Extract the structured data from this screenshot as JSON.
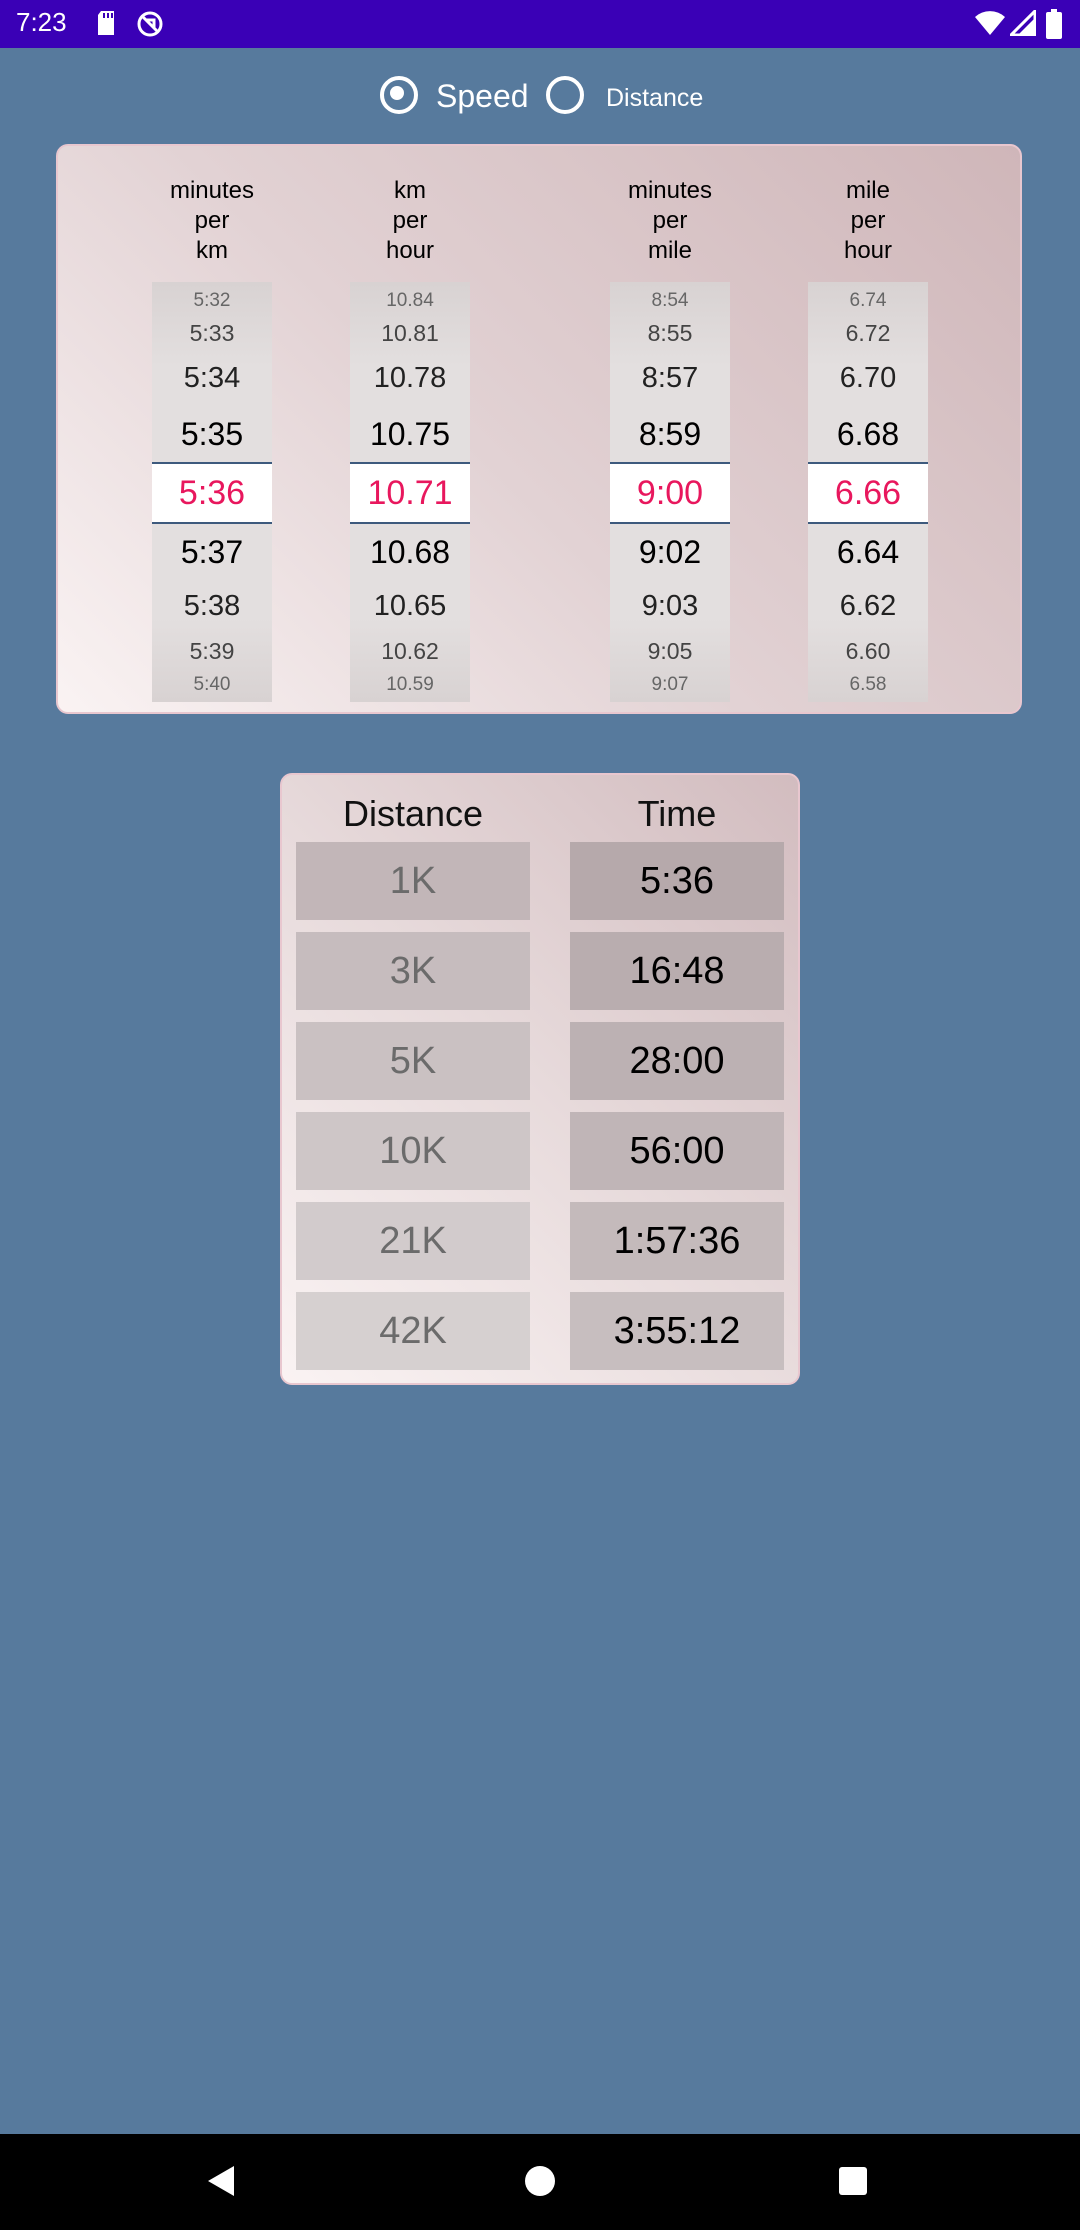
{
  "status_bar": {
    "time": "7:23",
    "icons": [
      "sd-card-icon",
      "sync-off-icon",
      "wifi-icon",
      "cell-signal-icon",
      "battery-icon"
    ],
    "color": "#3a00b6"
  },
  "mode": {
    "options": [
      {
        "label": "Speed",
        "checked": true
      },
      {
        "label": "Distance",
        "checked": false
      }
    ]
  },
  "pickers": [
    {
      "header": [
        "minutes",
        "per",
        "km"
      ],
      "above": [
        "5:32",
        "5:33",
        "5:34",
        "5:35"
      ],
      "selected": "5:36",
      "below": [
        "5:37",
        "5:38",
        "5:39",
        "5:40"
      ]
    },
    {
      "header": [
        "km",
        "per",
        "hour"
      ],
      "above": [
        "10.84",
        "10.81",
        "10.78",
        "10.75"
      ],
      "selected": "10.71",
      "below": [
        "10.68",
        "10.65",
        "10.62",
        "10.59"
      ]
    },
    {
      "header": [
        "minutes",
        "per",
        "mile"
      ],
      "above": [
        "8:54",
        "8:55",
        "8:57",
        "8:59"
      ],
      "selected": "9:00",
      "below": [
        "9:02",
        "9:03",
        "9:05",
        "9:07"
      ]
    },
    {
      "header": [
        "mile",
        "per",
        "hour"
      ],
      "above": [
        "6.74",
        "6.72",
        "6.70",
        "6.68"
      ],
      "selected": "6.66",
      "below": [
        "6.64",
        "6.62",
        "6.60",
        "6.58"
      ]
    }
  ],
  "results": {
    "distance_header": "Distance",
    "time_header": "Time",
    "rows": [
      {
        "distance": "1K",
        "time": "5:36"
      },
      {
        "distance": "3K",
        "time": "16:48"
      },
      {
        "distance": "5K",
        "time": "28:00"
      },
      {
        "distance": "10K",
        "time": "56:00"
      },
      {
        "distance": "21K",
        "time": "1:57:36"
      },
      {
        "distance": "42K",
        "time": "3:55:12"
      }
    ]
  },
  "colors": {
    "background": "#577a9d",
    "selected_value": "#e8175d",
    "selection_line": "#3d5a7d"
  }
}
